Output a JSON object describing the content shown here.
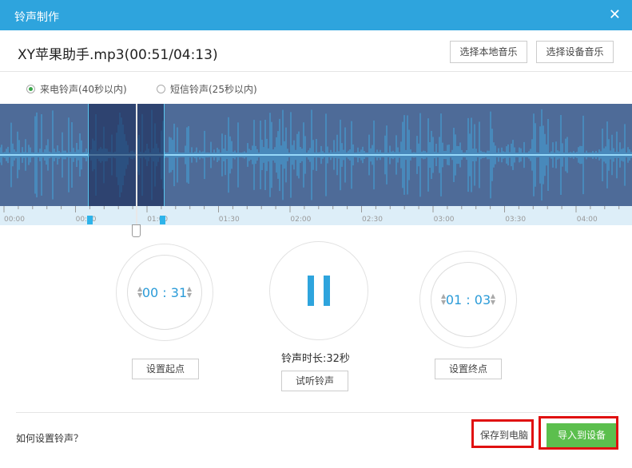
{
  "window": {
    "title": "铃声制作",
    "close_icon": "close-icon"
  },
  "file": {
    "label": "XY苹果助手.mp3(00:51/04:13)"
  },
  "buttons": {
    "local": "选择本地音乐",
    "device": "选择设备音乐",
    "set_start": "设置起点",
    "set_end": "设置终点",
    "preview": "试听铃声",
    "save": "保存到电脑",
    "import": "导入到设备"
  },
  "modes": [
    {
      "label": "来电铃声(40秒以内)",
      "selected": true
    },
    {
      "label": "短信铃声(25秒以内)",
      "selected": false
    }
  ],
  "timeline": {
    "ticks": [
      "00:00",
      "00:30",
      "01:00",
      "01:30",
      "02:00",
      "02:30",
      "03:00",
      "03:30",
      "04:00"
    ],
    "selection_start": "00:31",
    "selection_end": "01:03",
    "playhead": "00:51"
  },
  "start_time": "00 : 31",
  "end_time": "01 : 03",
  "duration_label": "铃声时长:32秒",
  "help_link": "如何设置铃声？",
  "colors": {
    "accent": "#2ea4dd",
    "wave": "#4e6b98",
    "import": "#5cbf4e"
  }
}
